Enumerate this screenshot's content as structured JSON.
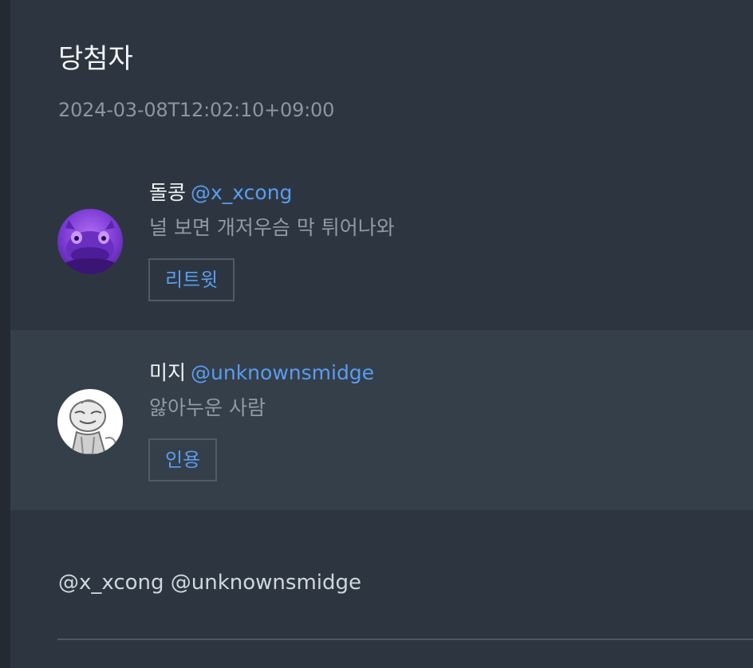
{
  "header": {
    "title": "당첨자",
    "timestamp": "2024-03-08T12:02:10+09:00"
  },
  "entries": [
    {
      "name": "돌콩",
      "handle": "@x_xcong",
      "text": "널 보면 개저우슴 막 튀어나와",
      "action_label": "리트윗",
      "avatar": "purple-creature-avatar"
    },
    {
      "name": "미지",
      "handle": "@unknownsmidge",
      "text": "앓아누운 사람",
      "action_label": "인용",
      "avatar": "sketch-person-avatar"
    }
  ],
  "footer": {
    "mentions": "@x_xcong @unknownsmidge"
  },
  "colors": {
    "background": "#2d3640",
    "highlight_row": "#343f49",
    "accent": "#5a9cf0",
    "muted_text": "#8f9aa5"
  }
}
